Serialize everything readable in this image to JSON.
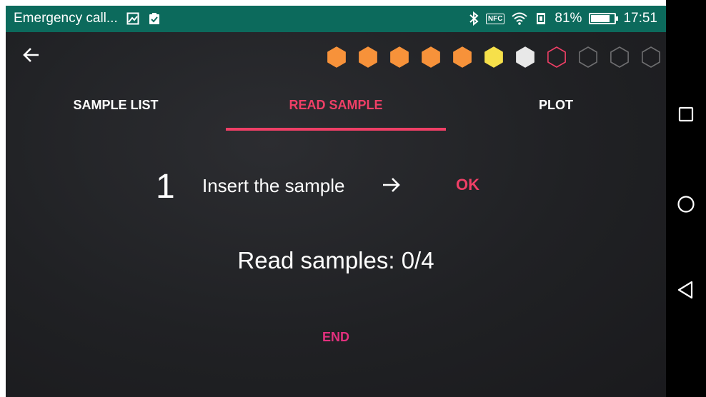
{
  "status_bar": {
    "notification_text": "Emergency call...",
    "left_icons": [
      "image-icon",
      "clipboard-check-icon"
    ],
    "right_icons": [
      "bluetooth-icon",
      "nfc-icon",
      "wifi-icon",
      "vibrate-icon"
    ],
    "nfc_label": "NFC",
    "battery_percent": "81%",
    "battery_level": 0.81,
    "time": "17:51"
  },
  "app_bar": {
    "back_icon": "arrow-left-icon",
    "progress_hexes": [
      {
        "state": "filled",
        "color": "#f7923a"
      },
      {
        "state": "filled",
        "color": "#f7923a"
      },
      {
        "state": "filled",
        "color": "#f7923a"
      },
      {
        "state": "filled",
        "color": "#f7923a"
      },
      {
        "state": "filled",
        "color": "#f7923a"
      },
      {
        "state": "filled",
        "color": "#f6e04a"
      },
      {
        "state": "filled",
        "color": "#e8e8e8"
      },
      {
        "state": "outline",
        "color": "#ef3f66"
      },
      {
        "state": "outline",
        "color": "#6e6e70"
      },
      {
        "state": "outline",
        "color": "#6e6e70"
      },
      {
        "state": "outline",
        "color": "#6e6e70"
      }
    ]
  },
  "tabs": [
    {
      "label": "SAMPLE LIST",
      "active": false
    },
    {
      "label": "READ SAMPLE",
      "active": true
    },
    {
      "label": "PLOT",
      "active": false
    }
  ],
  "main": {
    "step_number": "1",
    "step_text": "Insert the sample",
    "step_arrow_icon": "arrow-right-icon",
    "ok_label": "OK",
    "read_samples_text": "Read samples: 0/4",
    "end_label": "END"
  },
  "nav_bar": {
    "recents_icon": "square-icon",
    "home_icon": "circle-icon",
    "back_icon": "triangle-back-icon"
  },
  "colors": {
    "accent": "#ef3f66",
    "status_bar": "#0c6a5c",
    "end_button": "#e3307e",
    "background": "#202124"
  }
}
